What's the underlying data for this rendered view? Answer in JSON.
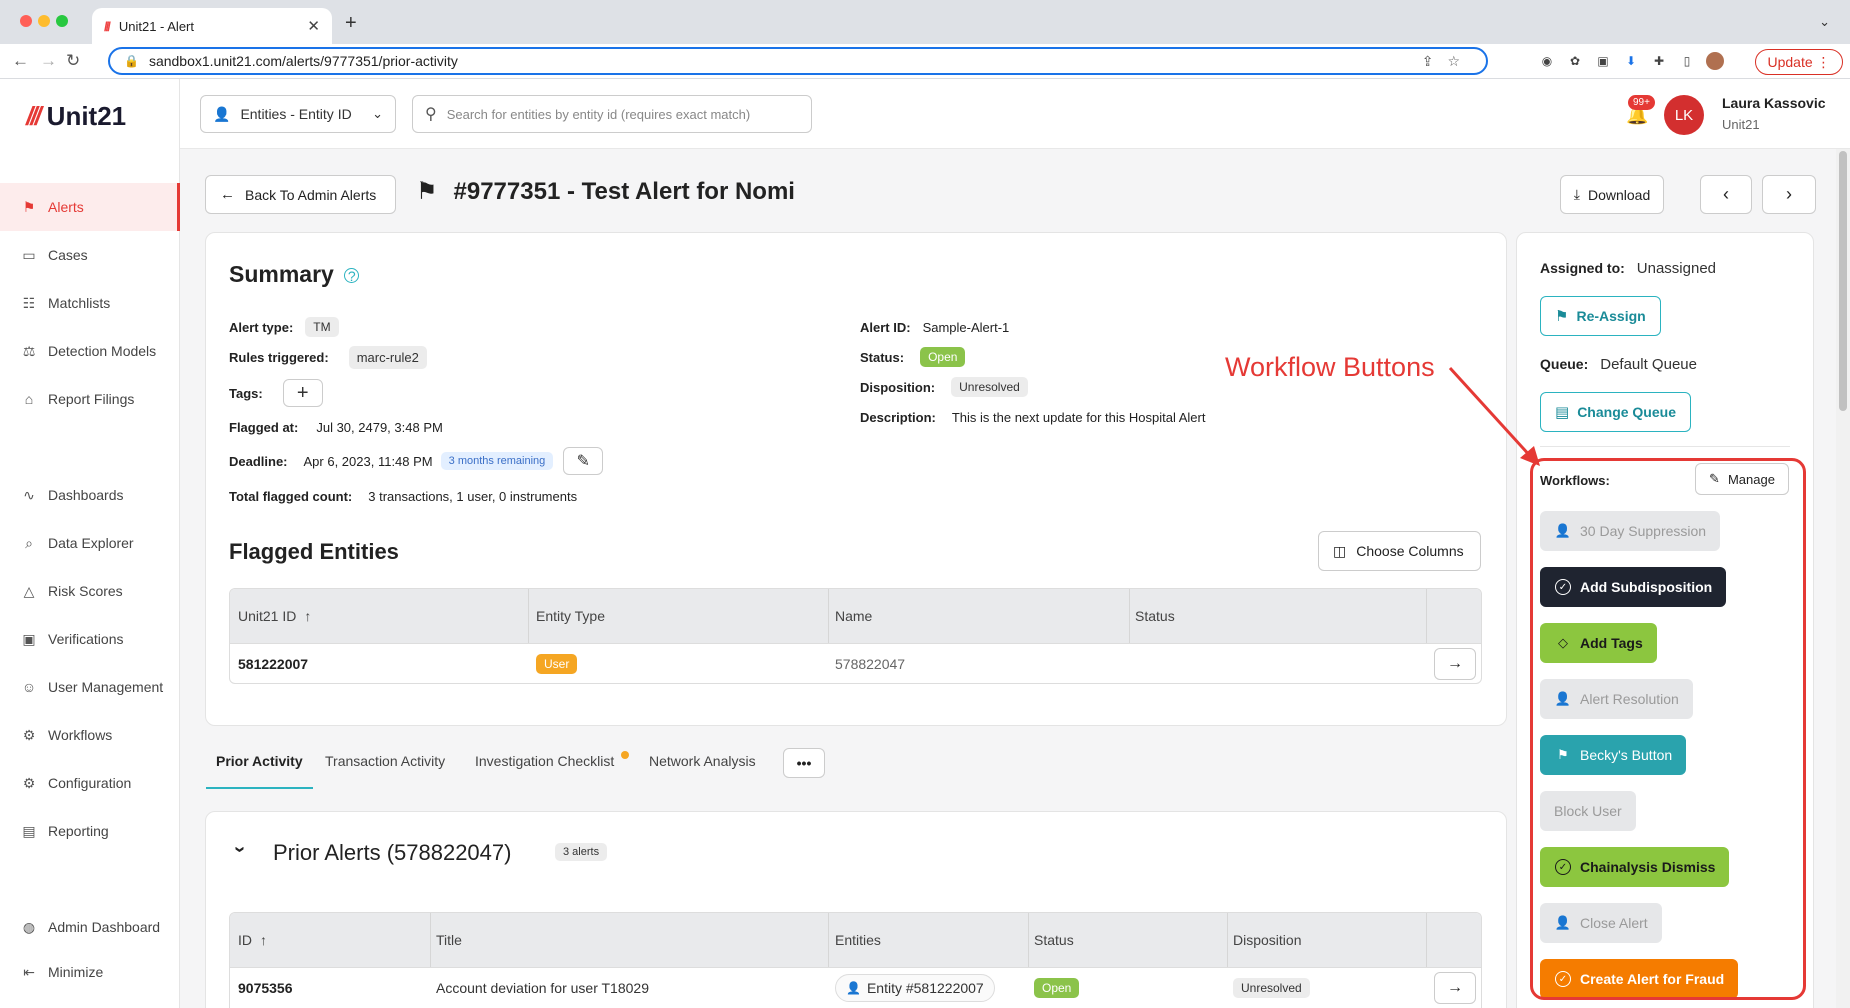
{
  "browser": {
    "tab_title": "Unit21 - Alert",
    "url": "sandbox1.unit21.com/alerts/9777351/prior-activity",
    "update_label": "Update"
  },
  "app": {
    "logo_text": "Unit21",
    "nav": [
      {
        "label": "Alerts",
        "icon": "flag-icon"
      },
      {
        "label": "Cases",
        "icon": "briefcase-icon"
      },
      {
        "label": "Matchlists",
        "icon": "user-list-icon"
      },
      {
        "label": "Detection Models",
        "icon": "scale-icon"
      },
      {
        "label": "Report Filings",
        "icon": "bank-icon"
      },
      {
        "label": "Dashboards",
        "icon": "chart-line-icon"
      },
      {
        "label": "Data Explorer",
        "icon": "explore-icon"
      },
      {
        "label": "Risk Scores",
        "icon": "warning-icon"
      },
      {
        "label": "Verifications",
        "icon": "id-card-icon"
      },
      {
        "label": "User Management",
        "icon": "users-icon"
      },
      {
        "label": "Workflows",
        "icon": "workflow-icon"
      },
      {
        "label": "Configuration",
        "icon": "gear-icon"
      },
      {
        "label": "Reporting",
        "icon": "report-icon"
      },
      {
        "label": "Admin Dashboard",
        "icon": "globe-icon"
      },
      {
        "label": "Minimize",
        "icon": "collapse-icon"
      }
    ]
  },
  "header": {
    "entity_select": "Entities - Entity ID",
    "search_placeholder": "Search for entities by entity id (requires exact match)",
    "notif_count": "99+",
    "user_initials": "LK",
    "user_name": "Laura Kassovic",
    "user_org": "Unit21"
  },
  "page": {
    "back_label": "Back To Admin Alerts",
    "title": "#9777351 - Test Alert for Nomi",
    "download_label": "Download"
  },
  "summary": {
    "title": "Summary",
    "alert_type_label": "Alert type:",
    "alert_type": "TM",
    "rules_label": "Rules triggered:",
    "rules": "marc-rule2",
    "tags_label": "Tags:",
    "flagged_at_label": "Flagged at:",
    "flagged_at": "Jul 30, 2479, 3:48 PM",
    "deadline_label": "Deadline:",
    "deadline": "Apr 6, 2023, 11:48 PM",
    "remaining": "3 months remaining",
    "total_label": "Total flagged count:",
    "total": "3 transactions, 1 user, 0 instruments",
    "alert_id_label": "Alert ID:",
    "alert_id": "Sample-Alert-1",
    "status_label": "Status:",
    "status": "Open",
    "disposition_label": "Disposition:",
    "disposition": "Unresolved",
    "description_label": "Description:",
    "description": "This is the next update for this Hospital Alert"
  },
  "flagged": {
    "title": "Flagged Entities",
    "choose_columns": "Choose Columns",
    "headers": [
      "Unit21 ID",
      "Entity Type",
      "Name",
      "Status"
    ],
    "row": {
      "id": "581222007",
      "type": "User",
      "name": "578822047",
      "status": ""
    }
  },
  "tabs": [
    "Prior Activity",
    "Transaction Activity",
    "Investigation Checklist",
    "Network Analysis"
  ],
  "prior": {
    "title": "Prior Alerts (578822047)",
    "count": "3 alerts",
    "headers": [
      "ID",
      "Title",
      "Entities",
      "Status",
      "Disposition"
    ],
    "row": {
      "id": "9075356",
      "title": "Account deviation for user T18029",
      "entity": "Entity #581222007",
      "status": "Open",
      "disposition": "Unresolved"
    }
  },
  "side": {
    "assigned_label": "Assigned to:",
    "assigned": "Unassigned",
    "reassign": "Re-Assign",
    "queue_label": "Queue:",
    "queue": "Default Queue",
    "change_queue": "Change Queue",
    "workflows_label": "Workflows:",
    "manage": "Manage",
    "workflows": [
      {
        "label": "30 Day Suppression",
        "style": "disabled"
      },
      {
        "label": "Add Subdisposition",
        "style": "dark"
      },
      {
        "label": "Add Tags",
        "style": "green"
      },
      {
        "label": "Alert Resolution",
        "style": "disabled"
      },
      {
        "label": "Becky's Button",
        "style": "teal"
      },
      {
        "label": "Block User",
        "style": "disabled"
      },
      {
        "label": "Chainalysis Dismiss",
        "style": "green"
      },
      {
        "label": "Close Alert",
        "style": "disabled"
      },
      {
        "label": "Create Alert for Fraud",
        "style": "orange"
      }
    ]
  },
  "annotation": "Workflow Buttons",
  "colors": {
    "brand_red": "#e53935",
    "teal": "#2aa3ad",
    "green": "#8cc63f",
    "orange": "#f57c00"
  }
}
